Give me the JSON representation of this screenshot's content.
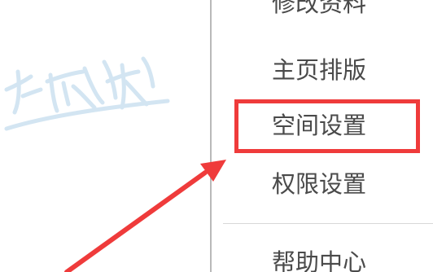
{
  "menu": {
    "items": [
      {
        "label": "修改资料"
      },
      {
        "label": "主页排版"
      },
      {
        "label": "空间设置"
      },
      {
        "label": "权限设置"
      },
      {
        "label": "帮助中心"
      }
    ]
  },
  "annotation": {
    "highlight_color": "#ef3b3b",
    "arrow_color": "#ef3b3b"
  },
  "colors": {
    "menu_text": "#4a4a4a",
    "divider": "#d8d8d8",
    "panel_border": "#b9b9b9",
    "watermark": "#cfe3f1"
  }
}
